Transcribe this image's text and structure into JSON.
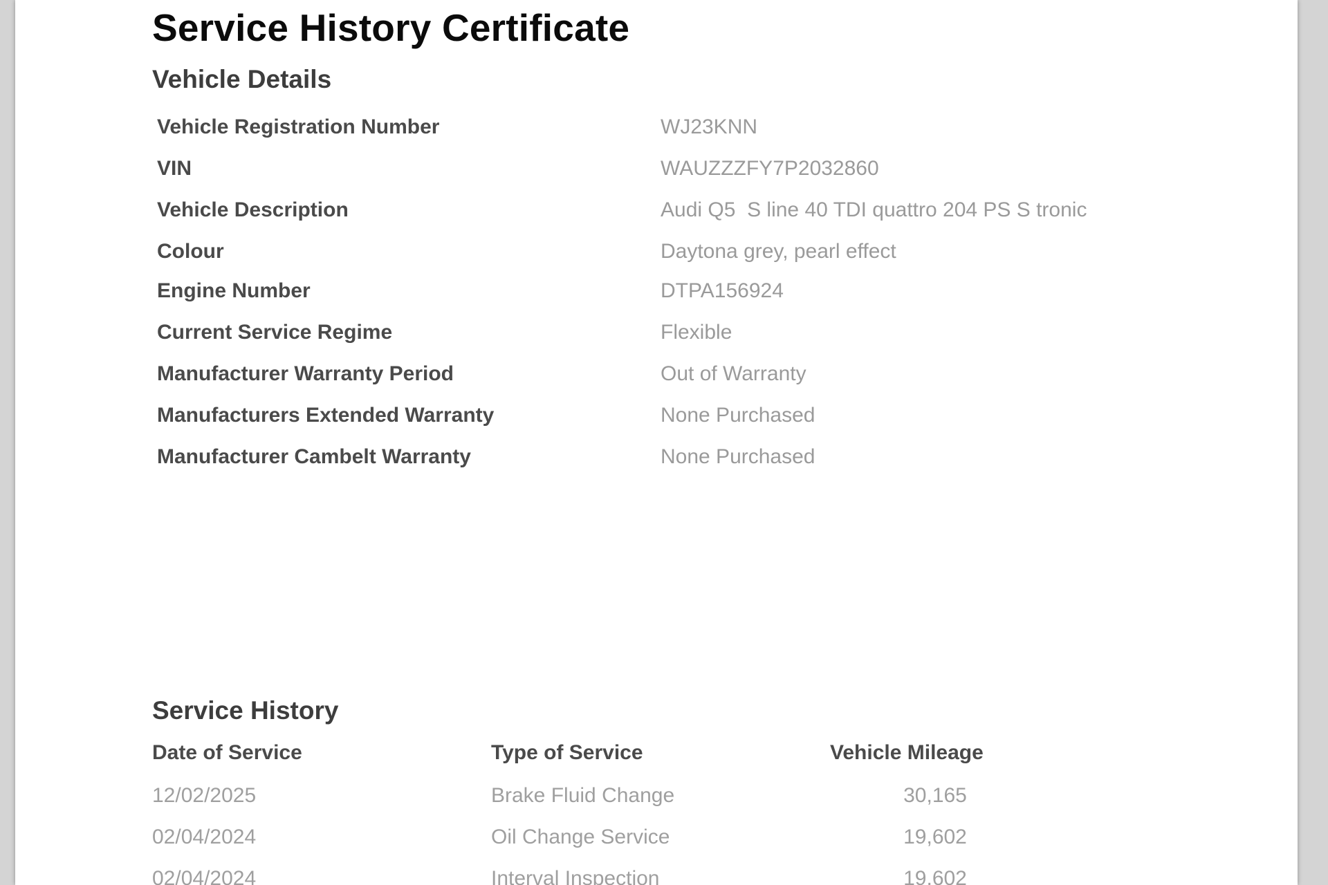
{
  "document": {
    "title": "Service History Certificate"
  },
  "vehicle_details": {
    "heading": "Vehicle Details",
    "rows": [
      {
        "label": "Vehicle Registration Number",
        "value": "WJ23KNN"
      },
      {
        "label": "VIN",
        "value": "WAUZZZFY7P2032860"
      },
      {
        "label": "Vehicle Description",
        "value": "Audi Q5  S line 40 TDI quattro 204 PS S tronic"
      },
      {
        "label": "Colour",
        "value": "Daytona grey, pearl effect"
      },
      {
        "label": "Engine Number",
        "value": "DTPA156924"
      },
      {
        "label": "Current Service Regime",
        "value": "Flexible"
      },
      {
        "label": "Manufacturer Warranty Period",
        "value": "Out of Warranty"
      },
      {
        "label": "Manufacturers Extended Warranty",
        "value": "None Purchased"
      },
      {
        "label": "Manufacturer Cambelt Warranty",
        "value": "None Purchased"
      }
    ]
  },
  "service_history": {
    "heading": "Service History",
    "columns": {
      "date": "Date of Service",
      "type": "Type of Service",
      "mileage": "Vehicle Mileage"
    },
    "rows": [
      {
        "date": "12/02/2025",
        "type": "Brake Fluid Change",
        "mileage": "30,165"
      },
      {
        "date": "02/04/2024",
        "type": "Oil Change Service",
        "mileage": "19,602"
      },
      {
        "date": "02/04/2024",
        "type": "Interval Inspection",
        "mileage": "19,602"
      }
    ]
  }
}
